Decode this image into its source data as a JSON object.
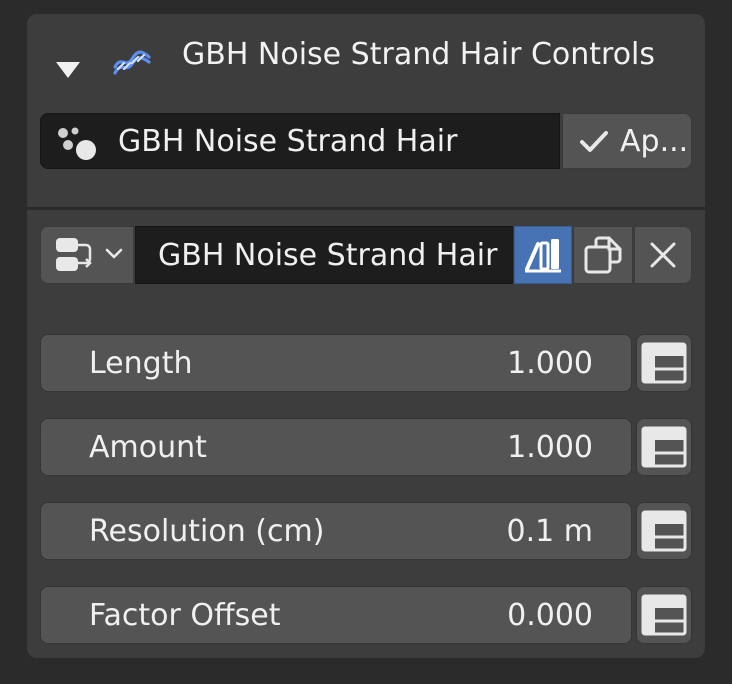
{
  "panel": {
    "title": "GBH Noise Strand Hair Controls",
    "collapse_icon": "triangle-down-icon",
    "header_icon": "hair-curves-icon"
  },
  "modifier": {
    "name": "GBH Noise Strand Hair",
    "type_icon": "particles-icon",
    "apply_label": "Ap...",
    "apply_icon": "checkmark-icon"
  },
  "node_group": {
    "type_icon": "node-tree-icon",
    "name": "GBH Noise Strand Hair",
    "fake_user_icon": "fake-user-icon",
    "fake_user_active": true,
    "duplicate_icon": "duplicate-icon",
    "unlink_icon": "x-icon"
  },
  "properties": [
    {
      "label": "Length",
      "value": "1.000"
    },
    {
      "label": "Amount",
      "value": "1.000"
    },
    {
      "label": "Resolution (cm)",
      "value": "0.1 m"
    },
    {
      "label": "Factor Offset",
      "value": "0.000"
    }
  ],
  "colors": {
    "panel_bg": "#3d3d3d",
    "field_dark": "#1d1d1d",
    "field_mid": "#545454",
    "accent_blue": "#4772b3",
    "text": "#f0f0f0"
  }
}
